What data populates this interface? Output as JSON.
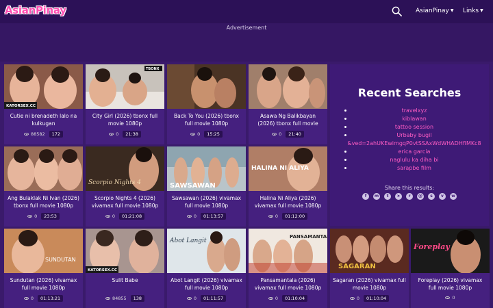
{
  "header": {
    "logo": "AsianPinay",
    "nav": [
      {
        "label": "AsianPinay"
      },
      {
        "label": "Links"
      }
    ]
  },
  "ad": {
    "label": "Advertisement"
  },
  "videos": [
    {
      "title": "Cutie ni brenadeth lalo na kulkugan",
      "views": "88582",
      "badge": "172"
    },
    {
      "title": "City Girl (2026) tbonx full movie 1080p",
      "views": "0",
      "badge": "21:38"
    },
    {
      "title": "Back To You (2026) tbonx full movie 1080p",
      "views": "0",
      "badge": "15:25"
    },
    {
      "title": "Asawa Ng Balikbayan (2026) tbonx full movie",
      "views": "0",
      "badge": "21:40"
    },
    {
      "title": "Ang Bulaklak Ni Ivan (2026) tbonx full movie 1080p",
      "views": "0",
      "badge": "23:53"
    },
    {
      "title": "Scorpio Nights 4 (2026) vivamax full movie 1080p",
      "views": "0",
      "badge": "01:21:08"
    },
    {
      "title": "Sawsawan (2026) vivamax full movie 1080p",
      "views": "0",
      "badge": "01:13:57"
    },
    {
      "title": "Halina Ni Aliya (2026) vivamax full movie 1080p",
      "views": "0",
      "badge": "01:12:00"
    },
    {
      "title": "Sundutan (2026) vivamax full movie 1080p",
      "views": "0",
      "badge": "01:13:21"
    },
    {
      "title": "Sulit Babe",
      "views": "84855",
      "badge": "138"
    },
    {
      "title": "Abot Langit (2026) vivamax full movie 1080p",
      "views": "0",
      "badge": "01:11:57"
    },
    {
      "title": "Pansamantala (2026) vivamax full movie 1080p",
      "views": "0",
      "badge": "01:10:04"
    },
    {
      "title": "Sagaran (2026) vivamax full movie 1080p",
      "views": "0",
      "badge": "01:10:04"
    },
    {
      "title": "Foreplay (2026) vivamax full movie 1080p",
      "views": "0",
      "badge": ""
    }
  ],
  "thumb_text": {
    "katorsex": "KATORSEX.CC",
    "tbonx": "TBONX",
    "scorpio": "Scorpio Nights 4",
    "sawsawan": "SAWSAWAN",
    "halina": "HALINA NI ALIYA",
    "sundutan": "SUNDUTAN",
    "abot": "Abot Langit",
    "pansamantala": "PANSAMANTALA",
    "sagaran": "SAGARAN",
    "foreplay": "Foreplay"
  },
  "recent": {
    "title": "Recent Searches",
    "items": [
      "travelxyz",
      "kiblawan",
      "tattoo session",
      "Urbaby bugil",
      "&ved=2ahUKEwimgqP0vtSSAxWdWHADHfIMKc8",
      "erica garcia",
      "naglulu ka diha bi",
      "sarapbe film"
    ],
    "share_label": "Share this results:",
    "share_icons": [
      "facebook-icon",
      "messenger-icon",
      "twitter-icon",
      "telegram-icon",
      "reddit-icon",
      "email-icon",
      "skype-icon",
      "viber-icon",
      "whatsapp-icon"
    ]
  },
  "colors": {
    "background": "#3a1a6b",
    "navbar": "#2c1157",
    "card": "#45207f",
    "link": "#ff5cc4",
    "logo": "#ff4fb3"
  }
}
